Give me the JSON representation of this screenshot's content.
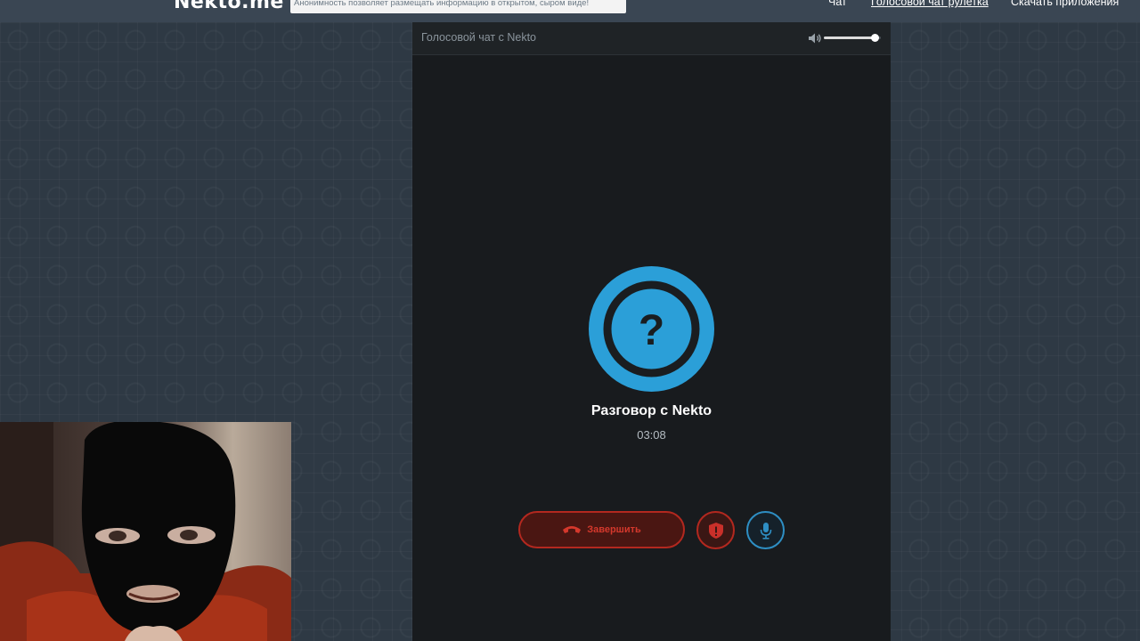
{
  "nav": {
    "logo": "Nekto.me",
    "tagline": "Анонимность позволяет размещать информацию в открытом, сыром виде!",
    "links": [
      {
        "label": "Чат"
      },
      {
        "label": "Голосовой чат рулетка"
      },
      {
        "label": "Скачать приложения"
      }
    ]
  },
  "panel": {
    "title": "Голосовой чат с Nekto",
    "volume_level": 0.9,
    "peer_name": "Разговор с Nekto",
    "timer": "03:08",
    "end_button_label": "Завершить"
  },
  "colors": {
    "accent_blue": "#2b9fd8",
    "danger_red": "#b3281f",
    "panel_bg": "#181b1e",
    "page_bg": "#2e3944"
  },
  "icons": {
    "avatar": "question-mark-icon",
    "volume": "speaker-icon",
    "end": "phone-hangup-icon",
    "report": "shield-alert-icon",
    "mic": "microphone-icon"
  }
}
